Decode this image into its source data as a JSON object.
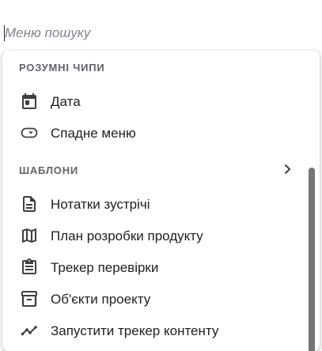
{
  "search": {
    "placeholder": "Меню пошуку"
  },
  "sections": {
    "smart_chips": {
      "header": "РОЗУМНІ ЧИПИ",
      "items": [
        {
          "label": "Дата",
          "icon": "calendar-icon"
        },
        {
          "label": "Спадне меню",
          "icon": "dropdown-chip-icon"
        }
      ]
    },
    "templates": {
      "header": "ШАБЛОНИ",
      "expand_icon": "chevron-right-icon",
      "items": [
        {
          "label": "Нотатки зустрічі",
          "icon": "document-icon"
        },
        {
          "label": "План розробки продукту",
          "icon": "map-icon"
        },
        {
          "label": "Трекер перевірки",
          "icon": "clipboard-icon"
        },
        {
          "label": "Об'єкти проекту",
          "icon": "archive-icon"
        },
        {
          "label": "Запустити трекер контенту",
          "icon": "timeline-icon"
        }
      ]
    }
  },
  "colors": {
    "text": "#202124",
    "header_text": "#5f6368",
    "icon": "#3c4043",
    "scrollbar": "#757575"
  }
}
